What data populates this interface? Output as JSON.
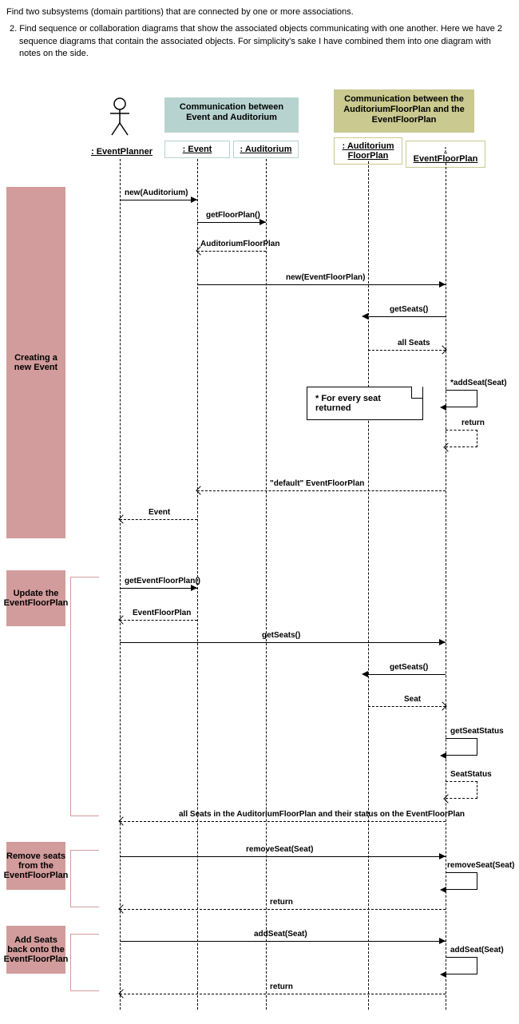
{
  "intro": {
    "line1": "Find two subsystems (domain partitions) that are connected by one or more associations.",
    "line2": "2.  Find sequence or collaboration diagrams that show the associated objects communicating with one another.  Here we have 2 sequence diagrams that contain the associated objects.  For simplicity's sake I have combined them into one diagram with notes on the side."
  },
  "comm": {
    "ea": "Communication between Event and Auditorium",
    "afp": "Communication between the AuditoriumFloorPlan and the EventFloorPlan"
  },
  "objects": {
    "planner": ": EventPlanner",
    "event": ": Event",
    "auditorium": ": Auditorium",
    "audFloorPlan": ": Auditorium FloorPlan",
    "eventFloorPlan": ": EventFloorPlan"
  },
  "notes": {
    "create": "Creating a new Event",
    "update": "Update the EventFloorPlan",
    "remove": "Remove seats from the EventFloorPlan",
    "add": "Add Seats back onto the EventFloorPlan",
    "seatloop": "* For every seat returned"
  },
  "messages": {
    "newAud": "new(Auditorium)",
    "getFloorPlan": "getFloorPlan()",
    "audFloorPlanRet": "AuditoriumFloorPlan",
    "newEFP": "new(EventFloorPlan)",
    "getSeats1": "getSeats()",
    "allSeats": "all Seats",
    "addSeat": "*addSeat(Seat)",
    "return1": "return",
    "defaultEFP": "\"default\" EventFloorPlan",
    "eventRet": "Event",
    "getEFP": "getEventFloorPlan()",
    "efpRet": "EventFloorPlan",
    "getSeats2": "getSeats()",
    "getSeats3": "getSeats()",
    "seat": "Seat",
    "getSeatStatus": "getSeatStatus",
    "seatStatus": "SeatStatus",
    "allSeatsStatus": "all Seats in the AuditoriumFloorPlan and their status on the EventFloorPlan",
    "removeSeat1": "removeSeat(Seat)",
    "removeSeat2": "removeSeat(Seat)",
    "return2": "return",
    "addSeat2": "addSeat(Seat)",
    "addSeat3": "addSeat(Seat)",
    "return3": "return"
  }
}
